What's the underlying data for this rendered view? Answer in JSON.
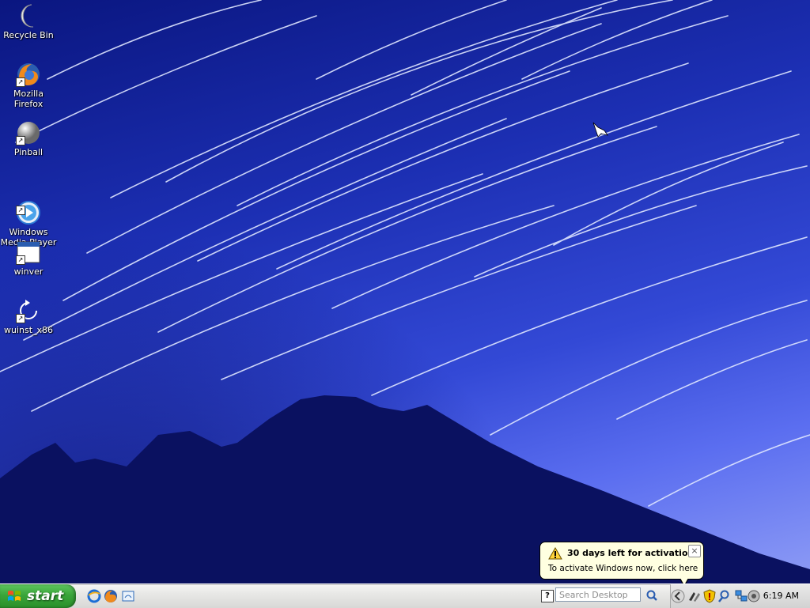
{
  "desktop": {
    "icons": [
      {
        "label": "Recycle Bin",
        "icon": "moon-recycle-bin-icon"
      },
      {
        "label": "Mozilla Firefox",
        "icon": "firefox-icon"
      },
      {
        "label": "Pinball",
        "icon": "pinball-icon"
      },
      {
        "label": "Windows\nMedia Player",
        "icon": "media-player-icon"
      },
      {
        "label": "winver",
        "icon": "window-icon"
      },
      {
        "label": "wuinst_x86",
        "icon": "refresh-icon"
      }
    ]
  },
  "balloon": {
    "title": "30 days left for activation",
    "text": "To activate Windows now, click here",
    "close": "×"
  },
  "taskbar": {
    "start_label": "start",
    "help_label": "?",
    "search_placeholder": "Search Desktop",
    "clock": "6:19 AM"
  },
  "colors": {
    "taskbar": "#e3e3e1",
    "start_button": "#3aa53a",
    "balloon_bg": "#ffffe1",
    "sky_dark": "#0a1680",
    "sky_light": "#8e9cf5",
    "mountain": "#0a1160"
  }
}
